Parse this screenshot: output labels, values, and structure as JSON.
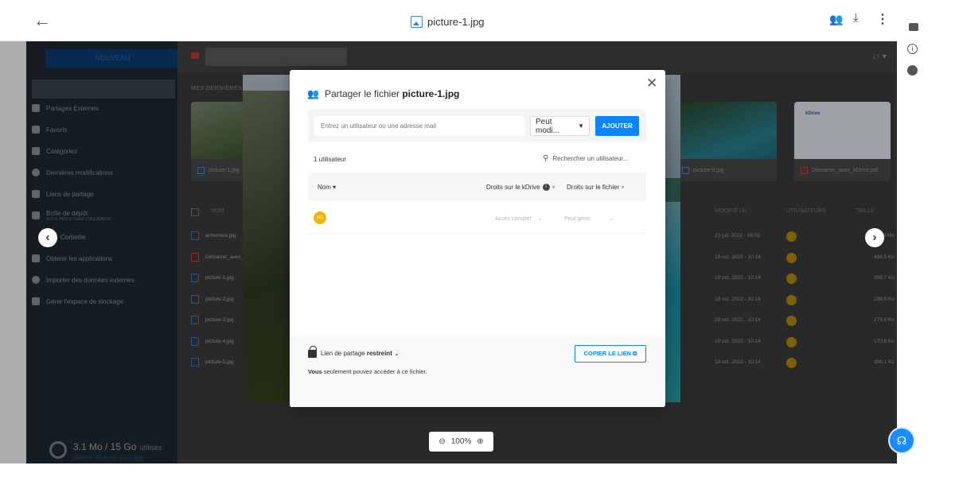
{
  "topbar": {
    "title": "picture-1.jpg"
  },
  "sidebar": {
    "new_label": "NOUVEAU",
    "items": [
      {
        "label": "Partages Externes"
      },
      {
        "label": "Favoris"
      },
      {
        "label": "Catégories"
      },
      {
        "label": "Dernières modifications"
      },
      {
        "label": "Liens de partage"
      },
      {
        "label": "Boîte de dépôt",
        "sub": "SOLO, PRO & TEAM UNIQUEMENT"
      },
      {
        "label": "Corbeille"
      },
      {
        "label": "Obtenir les applications"
      },
      {
        "label": "Importer des données externes"
      },
      {
        "label": "Gérer l'espace de stockage"
      }
    ],
    "quota": {
      "main": "3.1 Mo / 15 Go",
      "suffix": "utilisés",
      "link": "Obtenir plus de stockage"
    }
  },
  "main": {
    "recent_label": "MES DERNIÈRES",
    "cards": [
      {
        "name": "picture-1.jpg",
        "type": "image"
      },
      {
        "name": "picture-5.jpg",
        "type": "image"
      },
      {
        "name": "Démarrer_avec_kDrive.pdf",
        "type": "pdf",
        "brand": "kDrive"
      }
    ],
    "columns": {
      "name": "NOM",
      "modified": "MODIFIÉ LE",
      "users": "UTILISATEURS",
      "size": "TAILLE"
    },
    "rows": [
      {
        "name": "achensee.jpg",
        "date": "23 juil. 2022 - 08:50",
        "size": "1.9 Mo",
        "type": "image"
      },
      {
        "name": "Démarrer_avec_kDrive.pdf",
        "date": "18 oct. 2022 - 10:14",
        "size": "466.5 Ko",
        "type": "pdf"
      },
      {
        "name": "picture-1.jpg",
        "date": "18 oct. 2022 - 10:14",
        "size": "398.7 Ko",
        "type": "image"
      },
      {
        "name": "picture-2.jpg",
        "date": "18 oct. 2022 - 10:14",
        "size": "288.5 Ko",
        "type": "image"
      },
      {
        "name": "picture-3.jpg",
        "date": "18 oct. 2022 - 10:14",
        "size": "276.6 Ko",
        "type": "image"
      },
      {
        "name": "picture-4.jpg",
        "date": "18 oct. 2022 - 10:14",
        "size": "170.6 Ko",
        "type": "image"
      },
      {
        "name": "picture-5.jpg",
        "date": "18 oct. 2022 - 10:14",
        "size": "366.1 Ko",
        "type": "image"
      }
    ]
  },
  "zoom": {
    "value": "100%"
  },
  "modal": {
    "title_prefix": "Partager le fichier",
    "title_file": "picture-1.jpg",
    "input_placeholder": "Entrez un utilisateur ou une adresse mail",
    "permission": "Peut modi...",
    "add_label": "AJOUTER",
    "user_count": "1 utilisateur",
    "search_placeholder": "Rechercher un utilisateur...",
    "col_name": "Nom",
    "col_kdrive": "Droits sur le kDrive",
    "col_file": "Droits sur le fichier",
    "user": {
      "initials": "MG",
      "kdrive_right": "Accès complet",
      "file_right": "Peut gérer"
    },
    "link_prefix": "Lien de partage",
    "link_state": "restreint",
    "copy_label": "COPIER LE LIEN",
    "access_bold": "Vous",
    "access_text": "seulement pouvez accéder à ce fichier."
  },
  "colors": {
    "accent": "#0a84ff",
    "avatar": "#f5b400",
    "pdf": "#d14545"
  }
}
